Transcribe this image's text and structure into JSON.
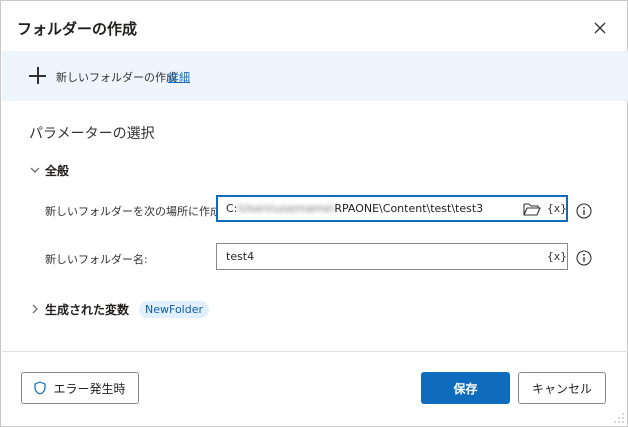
{
  "dialog": {
    "title": "フォルダーの作成"
  },
  "banner": {
    "description": "新しいフォルダーの作成",
    "details_link": "詳細"
  },
  "parameters": {
    "section_title": "パラメーターの選択",
    "general_label": "全般",
    "fields": [
      {
        "label": "新しいフォルダーを次の場所に作成:",
        "value_prefix": "C:",
        "value_blurred": "\\Users\\username\\",
        "value_suffix": "RPAONE\\Content\\test\\test3",
        "var_button": "{x}"
      },
      {
        "label": "新しいフォルダー名:",
        "value": "test4",
        "var_button": "{x}"
      }
    ]
  },
  "generated_variables": {
    "label": "生成された変数",
    "variable": "NewFolder"
  },
  "footer": {
    "on_error_label": "エラー発生時",
    "save_label": "保存",
    "cancel_label": "キャンセル"
  },
  "colors": {
    "accent": "#0f6cbd",
    "banner_bg": "#eff5fc",
    "pill_bg": "#e1efff"
  }
}
